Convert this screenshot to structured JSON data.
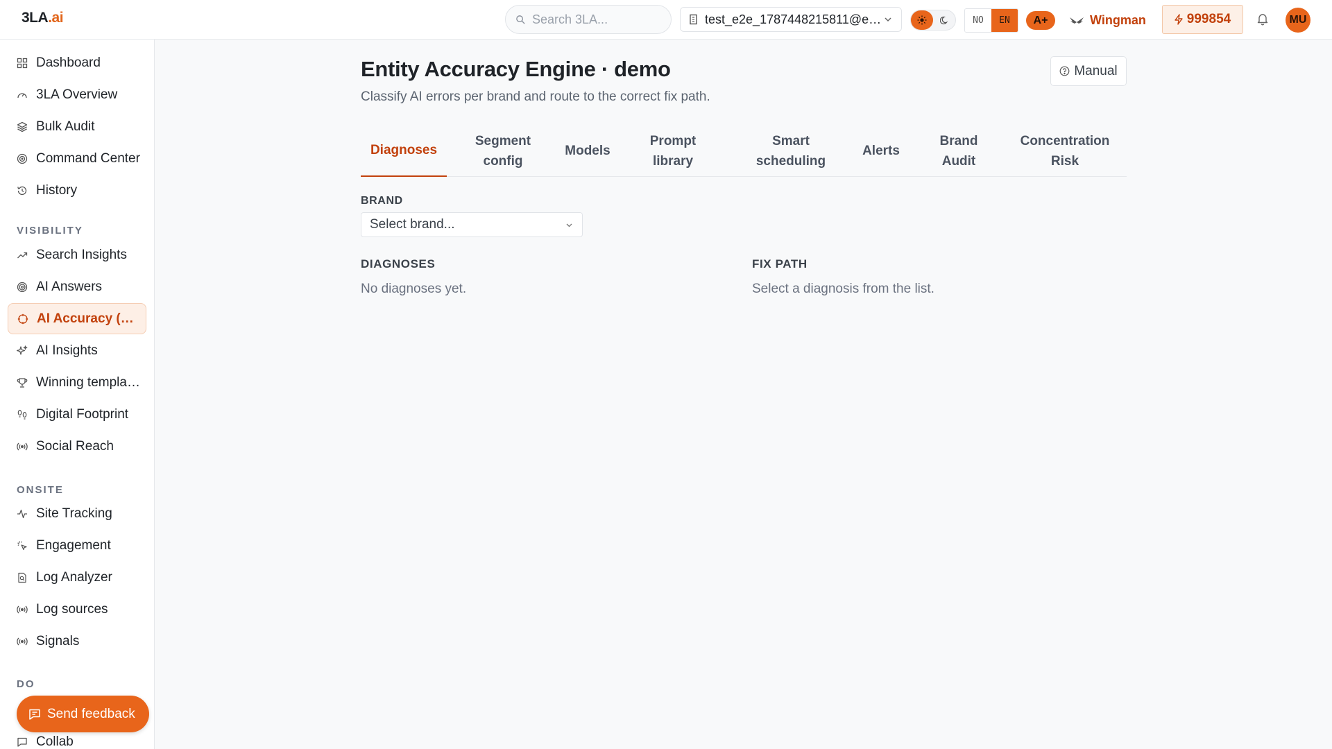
{
  "header": {
    "logo_main": "3LA",
    "logo_dot": ".ai",
    "search_placeholder": "Search 3LA...",
    "account": "test_e2e_1787448215811@example.com",
    "lang_no": "NO",
    "lang_en": "EN",
    "grade": "A+",
    "wingman": "Wingman",
    "credits": "999854",
    "avatar": "MU"
  },
  "sidebar": {
    "items_top": [
      "Dashboard",
      "3LA Overview",
      "Bulk Audit",
      "Command Center",
      "History"
    ],
    "section_visibility": "VISIBILITY",
    "items_visibility": [
      "Search Insights",
      "AI Answers",
      "AI Accuracy (Entity)",
      "AI Insights",
      "Winning templates",
      "Digital Footprint",
      "Social Reach"
    ],
    "section_onsite": "ONSITE",
    "items_onsite": [
      "Site Tracking",
      "Engagement",
      "Log Analyzer",
      "Log sources",
      "Signals"
    ],
    "section_do": "DO",
    "items_do": [
      "Collab"
    ],
    "feedback": "Send feedback"
  },
  "main": {
    "title": "Entity Accuracy Engine · demo",
    "subtitle": "Classify AI errors per brand and route to the correct fix path.",
    "manual": "Manual",
    "tabs": [
      {
        "l1": "Diagnoses",
        "l2": ""
      },
      {
        "l1": "Segment",
        "l2": "config"
      },
      {
        "l1": "Models",
        "l2": ""
      },
      {
        "l1": "Prompt",
        "l2": "library"
      },
      {
        "l1": "Smart",
        "l2": "scheduling"
      },
      {
        "l1": "Alerts",
        "l2": ""
      },
      {
        "l1": "Brand",
        "l2": "Audit"
      },
      {
        "l1": "Concentration",
        "l2": "Risk"
      }
    ],
    "brand_label": "BRAND",
    "brand_placeholder": "Select brand...",
    "diagnoses_label": "DIAGNOSES",
    "diagnoses_empty": "No diagnoses yet.",
    "fix_label": "FIX PATH",
    "fix_empty": "Select a diagnosis from the list."
  },
  "colors": {
    "accent": "#e8651b",
    "accent_text": "#c2410c"
  }
}
